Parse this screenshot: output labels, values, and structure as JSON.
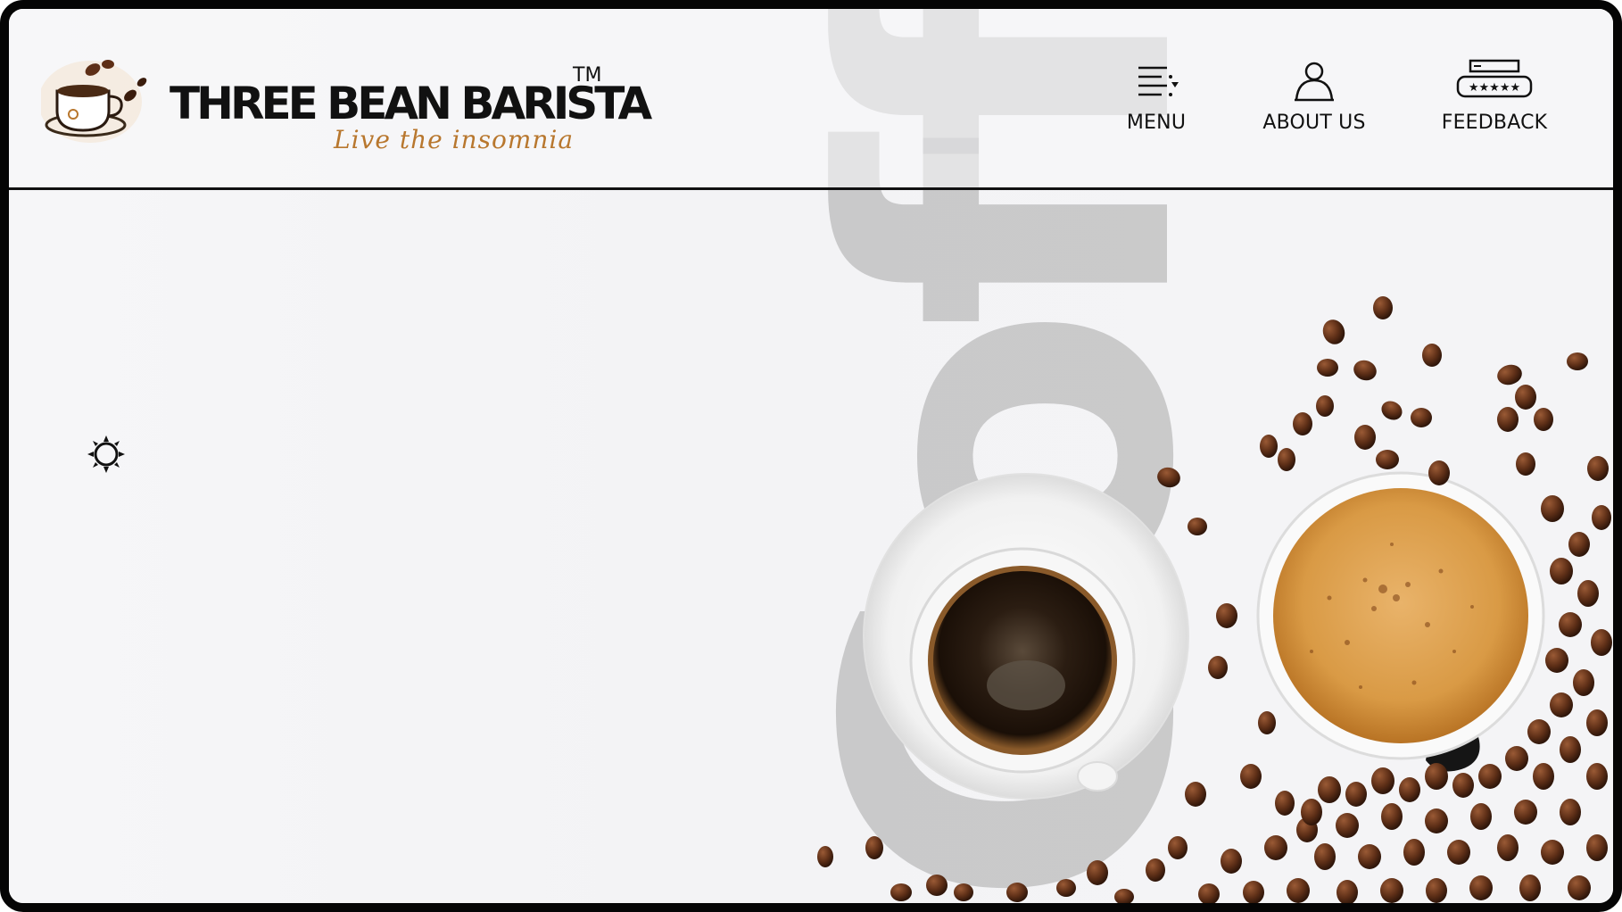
{
  "brand": {
    "name": "THREE BEAN BARISTA",
    "trademark": "TM",
    "tagline": "Live the insomnia",
    "logo_icon": "coffee-cup-logo-icon"
  },
  "nav": {
    "items": [
      {
        "label": "MENU",
        "icon": "menu-list-icon"
      },
      {
        "label": "ABOUT US",
        "icon": "user-icon"
      },
      {
        "label": "FEEDBACK",
        "icon": "rating-stars-icon"
      }
    ]
  },
  "hero": {
    "watermark": "Coffee",
    "theme_toggle_icon": "sun-icon"
  },
  "colors": {
    "frame": "#050505",
    "background": "#f3f3f5",
    "tagline": "#b8772e",
    "watermark": "#9a9a9a"
  }
}
